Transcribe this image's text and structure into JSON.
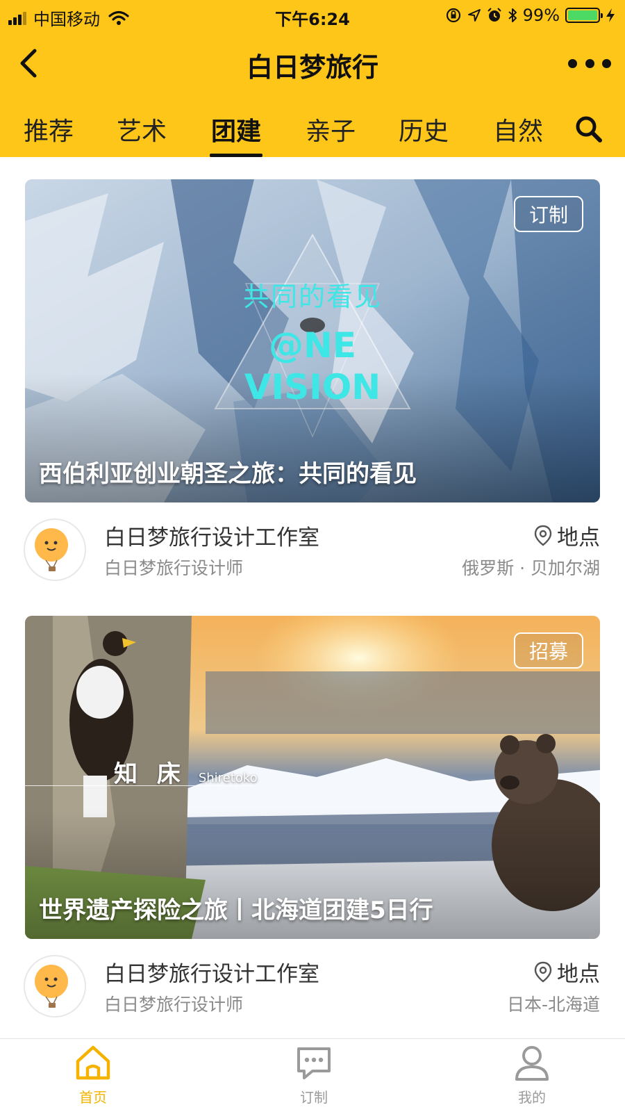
{
  "status_bar": {
    "carrier": "中国移动",
    "time": "下午6:24",
    "battery_text": "99%",
    "battery_level": 0.99,
    "battery_color": "#4CD964"
  },
  "header": {
    "title": "白日梦旅行",
    "background_color": "#FFC61A"
  },
  "tabs": [
    {
      "label": "推荐",
      "active": false
    },
    {
      "label": "艺术",
      "active": false
    },
    {
      "label": "团建",
      "active": true
    },
    {
      "label": "亲子",
      "active": false
    },
    {
      "label": "历史",
      "active": false
    },
    {
      "label": "自然",
      "active": false
    }
  ],
  "cards": [
    {
      "badge": "订制",
      "title": "西伯利亚创业朝圣之旅：共同的看见",
      "image_overlay": {
        "cn": "共同的看见",
        "en_line1": "@NE",
        "en_line2": "VISION"
      },
      "author_name": "白日梦旅行设计工作室",
      "author_role": "白日梦旅行设计师",
      "location_label": "地点",
      "location_value": "俄罗斯 · 贝加尔湖"
    },
    {
      "badge": "招募",
      "title": "世界遗产探险之旅丨北海道团建5日行",
      "image_overlay": {
        "cn": "知 床",
        "en": "Shiretoko"
      },
      "author_name": "白日梦旅行设计工作室",
      "author_role": "白日梦旅行设计师",
      "location_label": "地点",
      "location_value": "日本-北海道"
    }
  ],
  "bottom_nav": [
    {
      "label": "首页",
      "icon": "home-icon",
      "active": true
    },
    {
      "label": "订制",
      "icon": "chat-bubble-icon",
      "active": false
    },
    {
      "label": "我的",
      "icon": "user-icon",
      "active": false
    }
  ],
  "colors": {
    "accent": "#FFC61A",
    "active_nav": "#F5B300",
    "inactive_nav": "#9a9a9a"
  }
}
